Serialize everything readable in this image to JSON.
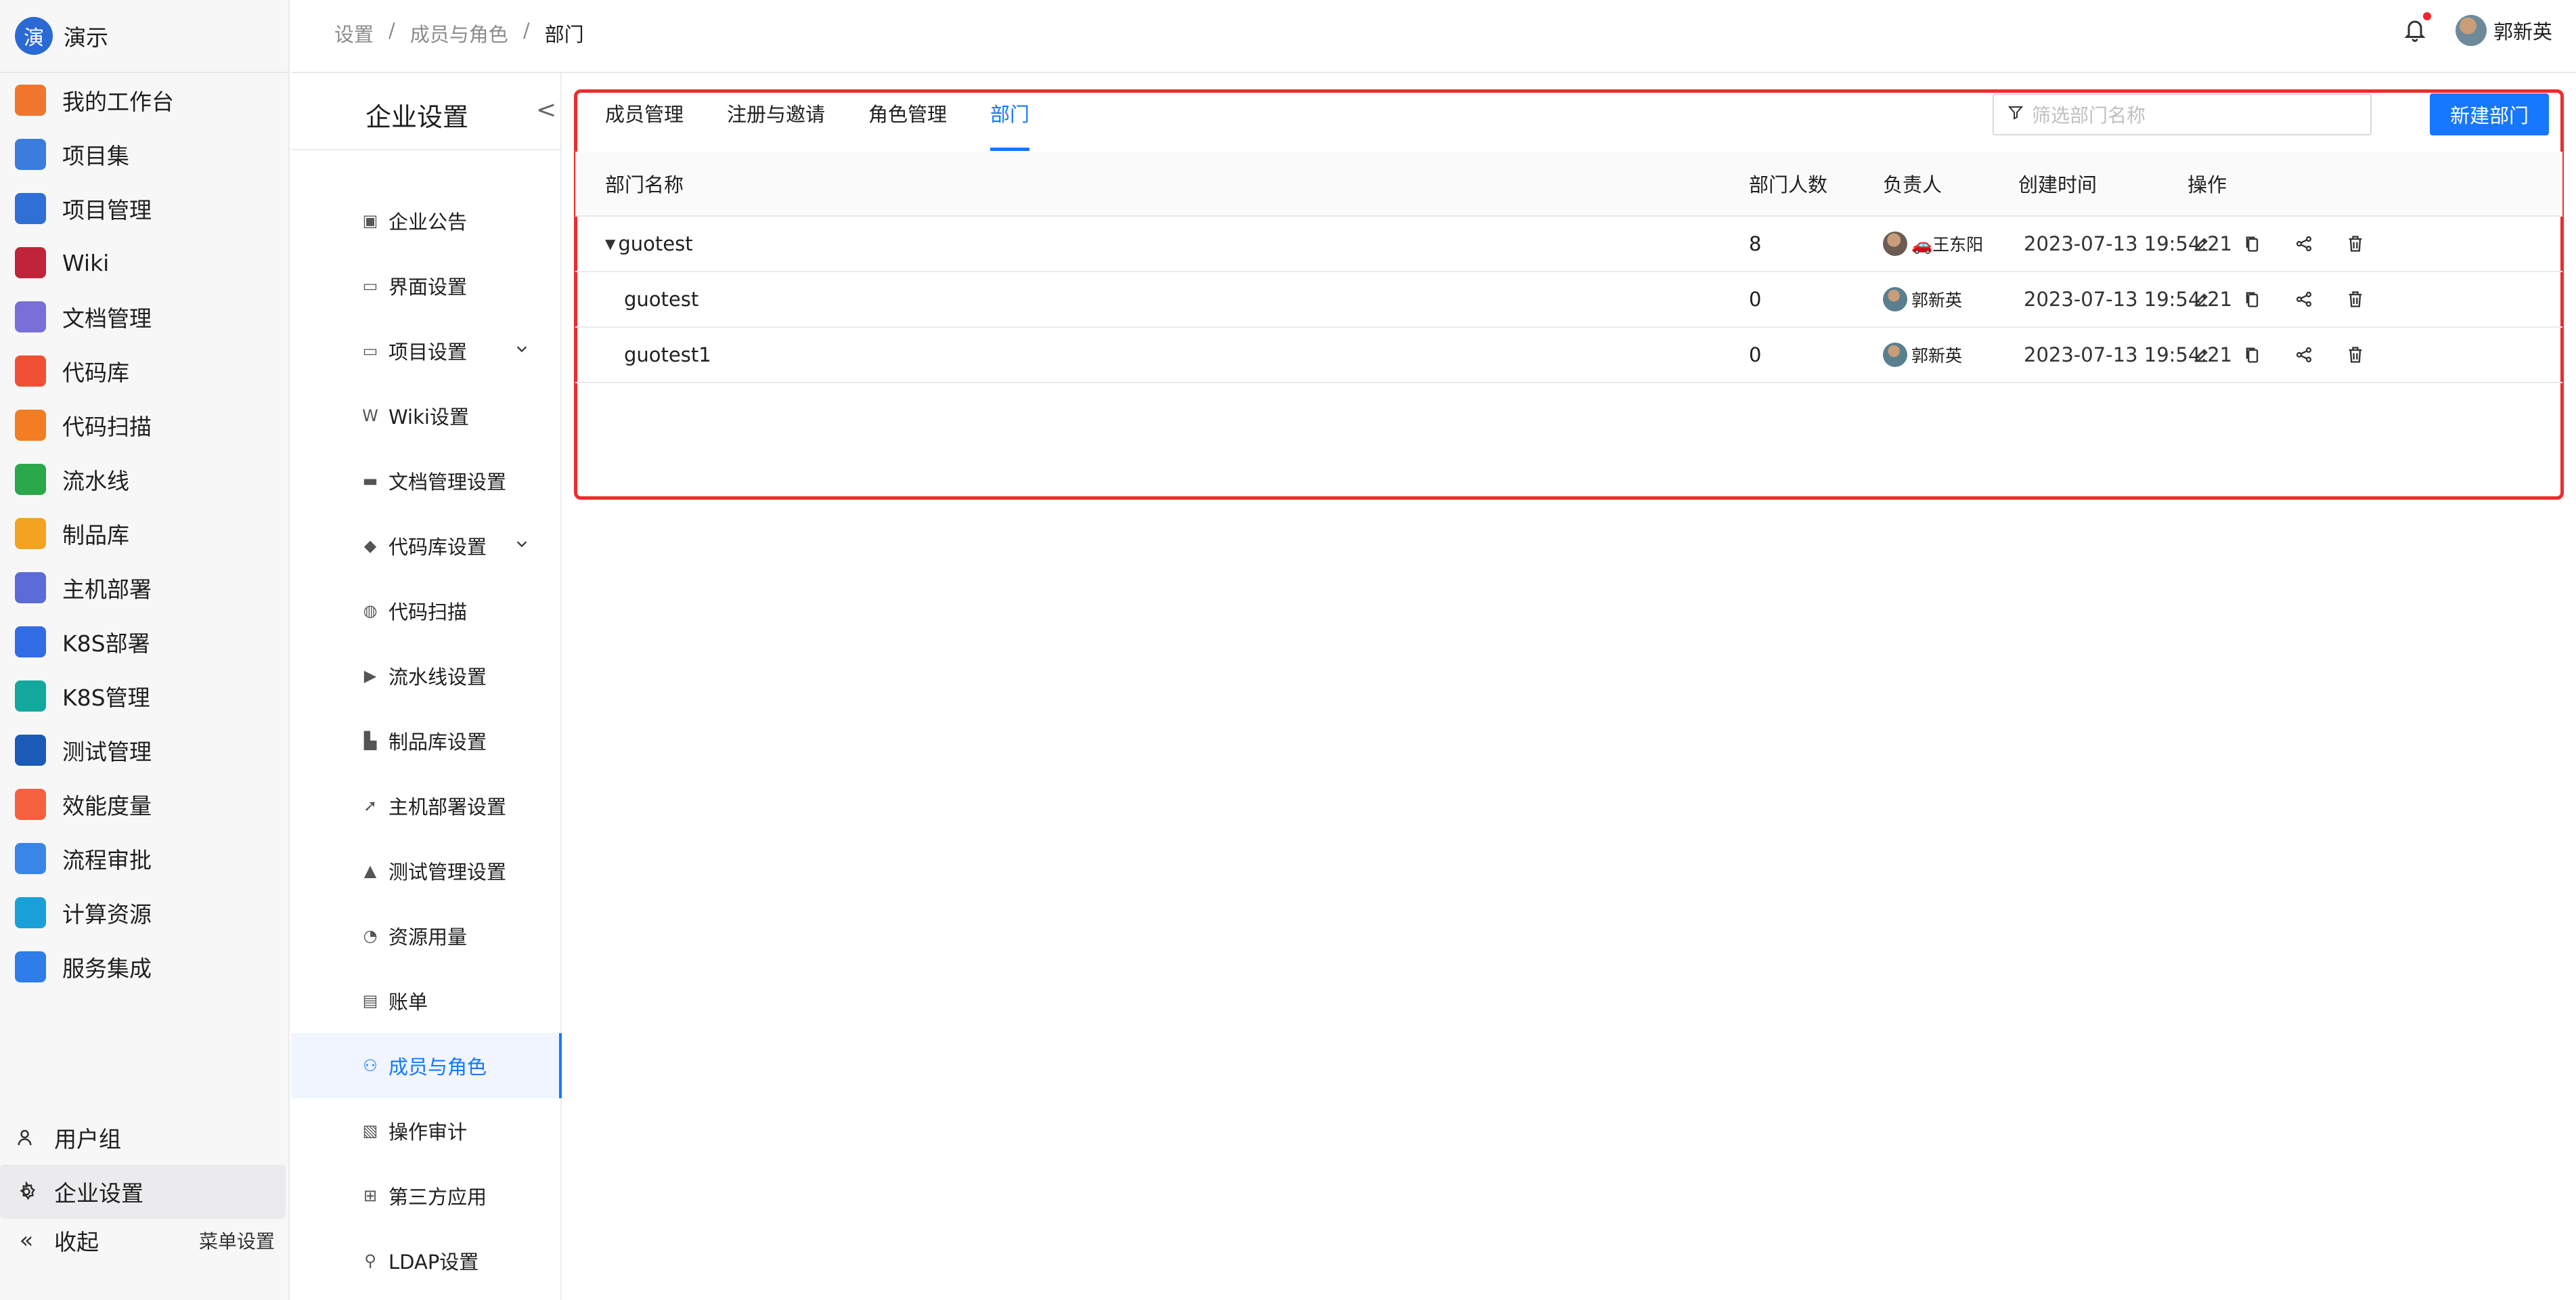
{
  "app": {
    "logo_char": "演",
    "name": "演示"
  },
  "nav": {
    "items": [
      {
        "label": "我的工作台",
        "icon": "workbench-icon",
        "color": "#f0762d"
      },
      {
        "label": "项目集",
        "icon": "project-set-icon",
        "color": "#3b7ddd"
      },
      {
        "label": "项目管理",
        "icon": "project-manage-icon",
        "color": "#2f6fd6"
      },
      {
        "label": "Wiki",
        "icon": "wiki-icon",
        "color": "#c0243a"
      },
      {
        "label": "文档管理",
        "icon": "document-icon",
        "color": "#7a6fd8"
      },
      {
        "label": "代码库",
        "icon": "git-icon",
        "color": "#f05033"
      },
      {
        "label": "代码扫描",
        "icon": "code-scan-icon",
        "color": "#f27d22"
      },
      {
        "label": "流水线",
        "icon": "pipeline-icon",
        "color": "#2ba84a"
      },
      {
        "label": "制品库",
        "icon": "artifact-icon",
        "color": "#f3a321"
      },
      {
        "label": "主机部署",
        "icon": "rocket-icon",
        "color": "#5b6bd8"
      },
      {
        "label": "K8S部署",
        "icon": "k8s-icon",
        "color": "#326ce5"
      },
      {
        "label": "K8S管理",
        "icon": "k8s-manage-icon",
        "color": "#13a89e"
      },
      {
        "label": "测试管理",
        "icon": "flask-icon",
        "color": "#1c5ab8"
      },
      {
        "label": "效能度量",
        "icon": "metrics-icon",
        "color": "#f5613f"
      },
      {
        "label": "流程审批",
        "icon": "approval-icon",
        "color": "#3a86e8"
      },
      {
        "label": "计算资源",
        "icon": "compute-icon",
        "color": "#1aa0d8"
      },
      {
        "label": "服务集成",
        "icon": "integration-icon",
        "color": "#2f7de8"
      }
    ],
    "bottom": [
      {
        "label": "用户组",
        "icon": "user-group-icon"
      },
      {
        "label": "企业设置",
        "icon": "gear-icon"
      }
    ],
    "collapse_label": "收起",
    "menu_setting_label": "菜单设置"
  },
  "header": {
    "breadcrumb": [
      "设置",
      "成员与角色",
      "部门"
    ],
    "user_name": "郭新英"
  },
  "settings": {
    "title": "企业设置",
    "items": [
      {
        "label": "企业公告",
        "icon": "announcement-icon",
        "glyph": "▣"
      },
      {
        "label": "界面设置",
        "icon": "layout-icon",
        "glyph": "▭"
      },
      {
        "label": "项目设置",
        "icon": "project-icon",
        "glyph": "▭",
        "expand": true
      },
      {
        "label": "Wiki设置",
        "icon": "wiki-icon",
        "glyph": "W"
      },
      {
        "label": "文档管理设置",
        "icon": "document-icon",
        "glyph": "▬"
      },
      {
        "label": "代码库设置",
        "icon": "git-icon",
        "glyph": "◆",
        "expand": true
      },
      {
        "label": "代码扫描",
        "icon": "globe-icon",
        "glyph": "◍"
      },
      {
        "label": "流水线设置",
        "icon": "pipeline-icon",
        "glyph": "▶"
      },
      {
        "label": "制品库设置",
        "icon": "artifact-icon",
        "glyph": "▙"
      },
      {
        "label": "主机部署设置",
        "icon": "rocket-icon",
        "glyph": "➚"
      },
      {
        "label": "测试管理设置",
        "icon": "flask-icon",
        "glyph": "▲"
      },
      {
        "label": "资源用量",
        "icon": "pie-icon",
        "glyph": "◔"
      },
      {
        "label": "账单",
        "icon": "bill-icon",
        "glyph": "▤"
      },
      {
        "label": "成员与角色",
        "icon": "user-icon",
        "glyph": "⚇",
        "active": true
      },
      {
        "label": "操作审计",
        "icon": "audit-icon",
        "glyph": "▧"
      },
      {
        "label": "第三方应用",
        "icon": "apps-icon",
        "glyph": "⊞"
      },
      {
        "label": "LDAP设置",
        "icon": "ldap-icon",
        "glyph": "⚲"
      }
    ]
  },
  "tabs": [
    "成员管理",
    "注册与邀请",
    "角色管理",
    "部门"
  ],
  "active_tab": 3,
  "search": {
    "placeholder": "筛选部门名称"
  },
  "new_button": "新建部门",
  "table": {
    "headers": {
      "name": "部门名称",
      "count": "部门人数",
      "lead": "负责人",
      "time": "创建时间",
      "ops": "操作"
    },
    "rows": [
      {
        "name": "guotest",
        "count": "8",
        "lead": "🚗王东阳",
        "time": "2023-07-13 19:54:21",
        "expanded": true
      },
      {
        "name": "guotest",
        "count": "0",
        "lead": "郭新英",
        "time": "2023-07-13 19:54:21",
        "child": true
      },
      {
        "name": "guotest1",
        "count": "0",
        "lead": "郭新英",
        "time": "2023-07-13 19:54:21",
        "child": true
      }
    ]
  },
  "colors": {
    "accent": "#1677ff",
    "highlight": "#ee2c2c"
  }
}
